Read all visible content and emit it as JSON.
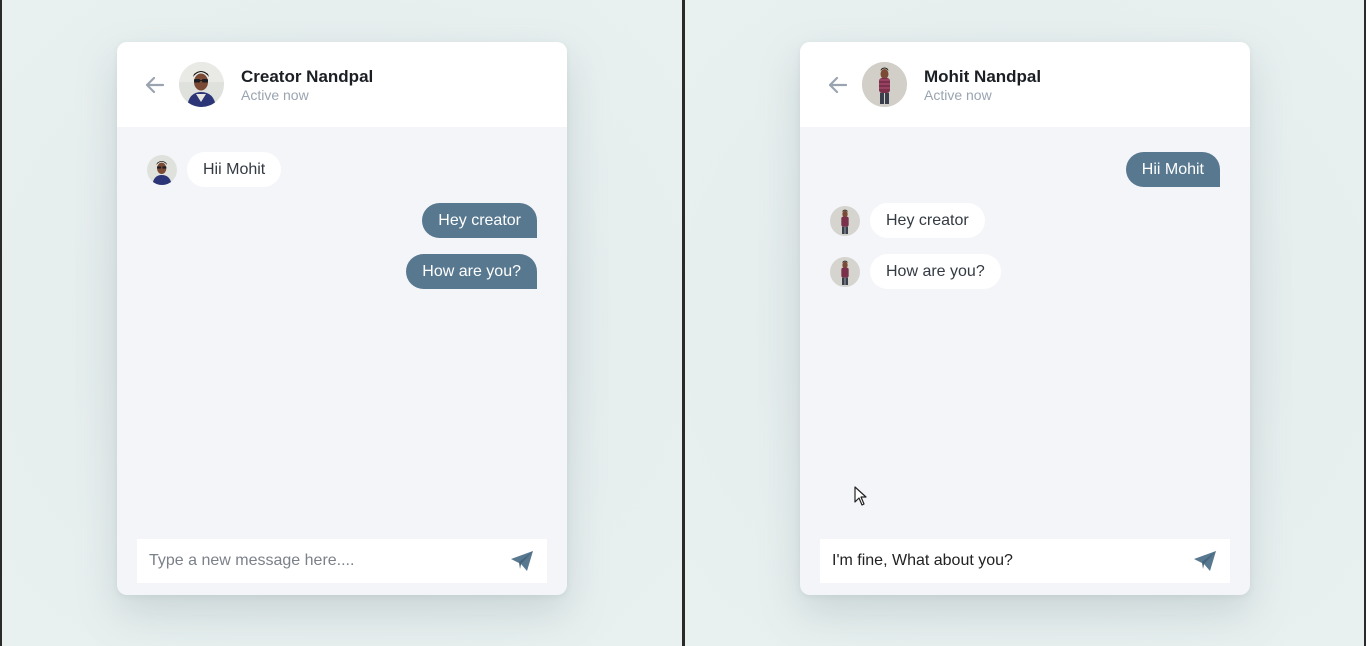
{
  "colors": {
    "accent": "#587890",
    "background": "#e6eeee",
    "card": "#f3f5f9",
    "muted": "#9aa4b1"
  },
  "left_chat": {
    "header": {
      "back_icon": "arrow-left-icon",
      "name": "Creator Nandpal",
      "status": "Active now"
    },
    "messages": [
      {
        "direction": "in",
        "text": "Hii Mohit"
      },
      {
        "direction": "out",
        "text": "Hey creator"
      },
      {
        "direction": "out",
        "text": "How are you?"
      }
    ],
    "composer": {
      "placeholder": "Type a new message here....",
      "value": "",
      "send_icon": "paper-plane-icon"
    }
  },
  "right_chat": {
    "header": {
      "back_icon": "arrow-left-icon",
      "name": "Mohit Nandpal",
      "status": "Active now"
    },
    "messages": [
      {
        "direction": "out",
        "text": "Hii Mohit"
      },
      {
        "direction": "in",
        "text": "Hey creator"
      },
      {
        "direction": "in",
        "text": "How are you?"
      }
    ],
    "composer": {
      "placeholder": "Type a new message here....",
      "value": "I'm fine, What about you?",
      "send_icon": "paper-plane-icon"
    }
  }
}
